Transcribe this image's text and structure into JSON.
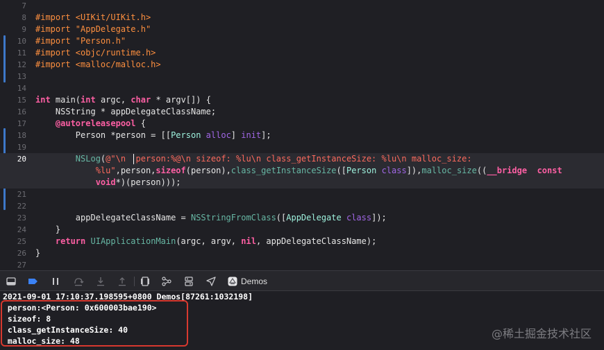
{
  "editor": {
    "lines": [
      {
        "num": "7",
        "tokens": []
      },
      {
        "num": "8",
        "tokens": [
          {
            "t": "#import ",
            "c": "pre"
          },
          {
            "t": "<UIKit/UIKit.h>",
            "c": "pre"
          }
        ]
      },
      {
        "num": "9",
        "tokens": [
          {
            "t": "#import ",
            "c": "pre"
          },
          {
            "t": "\"AppDelegate.h\"",
            "c": "pre"
          }
        ]
      },
      {
        "num": "10",
        "tokens": [
          {
            "t": "#import ",
            "c": "pre"
          },
          {
            "t": "\"Person.h\"",
            "c": "pre"
          }
        ]
      },
      {
        "num": "11",
        "tokens": [
          {
            "t": "#import ",
            "c": "pre"
          },
          {
            "t": "<objc/runtime.h>",
            "c": "pre"
          }
        ]
      },
      {
        "num": "12",
        "tokens": [
          {
            "t": "#import ",
            "c": "pre"
          },
          {
            "t": "<malloc/malloc.h>",
            "c": "pre"
          }
        ]
      },
      {
        "num": "13",
        "tokens": []
      },
      {
        "num": "14",
        "tokens": []
      },
      {
        "num": "15",
        "tokens": [
          {
            "t": "int",
            "c": "kw"
          },
          {
            "t": " main(",
            "c": "plain"
          },
          {
            "t": "int",
            "c": "kw"
          },
          {
            "t": " argc, ",
            "c": "plain"
          },
          {
            "t": "char",
            "c": "kw"
          },
          {
            "t": " * argv[]) {",
            "c": "plain"
          }
        ]
      },
      {
        "num": "16",
        "tokens": [
          {
            "t": "    NSString * appDelegateClassName;",
            "c": "plain"
          }
        ]
      },
      {
        "num": "17",
        "tokens": [
          {
            "t": "    ",
            "c": "plain"
          },
          {
            "t": "@autoreleasepool",
            "c": "kw"
          },
          {
            "t": " {",
            "c": "plain"
          }
        ]
      },
      {
        "num": "18",
        "tokens": [
          {
            "t": "        Person *person = [[",
            "c": "plain"
          },
          {
            "t": "Person",
            "c": "cls"
          },
          {
            "t": " ",
            "c": "plain"
          },
          {
            "t": "alloc",
            "c": "api"
          },
          {
            "t": "] ",
            "c": "plain"
          },
          {
            "t": "init",
            "c": "api"
          },
          {
            "t": "];",
            "c": "plain"
          }
        ]
      },
      {
        "num": "19",
        "tokens": []
      },
      {
        "num": "20",
        "tokens": [
          {
            "t": "        ",
            "c": "plain"
          },
          {
            "t": "NSLog",
            "c": "fn"
          },
          {
            "t": "(",
            "c": "plain"
          },
          {
            "t": "@\"\\n  person:%@\\n sizeof: %lu\\n class_getInstanceSize: %lu\\n malloc_size:",
            "c": "str"
          }
        ]
      },
      {
        "num": "",
        "tokens": [
          {
            "t": "            ",
            "c": "plain"
          },
          {
            "t": "%lu\"",
            "c": "str"
          },
          {
            "t": ",person,",
            "c": "plain"
          },
          {
            "t": "sizeof",
            "c": "kw"
          },
          {
            "t": "(person),",
            "c": "plain"
          },
          {
            "t": "class_getInstanceSize",
            "c": "fn"
          },
          {
            "t": "([",
            "c": "plain"
          },
          {
            "t": "Person",
            "c": "cls"
          },
          {
            "t": " ",
            "c": "plain"
          },
          {
            "t": "class",
            "c": "api"
          },
          {
            "t": "]),",
            "c": "plain"
          },
          {
            "t": "malloc_size",
            "c": "fn"
          },
          {
            "t": "((",
            "c": "plain"
          },
          {
            "t": "__bridge",
            "c": "kw"
          },
          {
            "t": "  ",
            "c": "plain"
          },
          {
            "t": "const",
            "c": "kw"
          }
        ]
      },
      {
        "num": "",
        "tokens": [
          {
            "t": "            ",
            "c": "plain"
          },
          {
            "t": "void",
            "c": "kw"
          },
          {
            "t": "*)(person)));",
            "c": "plain"
          }
        ]
      },
      {
        "num": "21",
        "tokens": []
      },
      {
        "num": "22",
        "tokens": []
      },
      {
        "num": "23",
        "tokens": [
          {
            "t": "        appDelegateClassName = ",
            "c": "plain"
          },
          {
            "t": "NSStringFromClass",
            "c": "fn"
          },
          {
            "t": "([",
            "c": "plain"
          },
          {
            "t": "AppDelegate",
            "c": "cls"
          },
          {
            "t": " ",
            "c": "plain"
          },
          {
            "t": "class",
            "c": "api"
          },
          {
            "t": "]);",
            "c": "plain"
          }
        ]
      },
      {
        "num": "24",
        "tokens": [
          {
            "t": "    }",
            "c": "plain"
          }
        ]
      },
      {
        "num": "25",
        "tokens": [
          {
            "t": "    ",
            "c": "plain"
          },
          {
            "t": "return",
            "c": "kw"
          },
          {
            "t": " ",
            "c": "plain"
          },
          {
            "t": "UIApplicationMain",
            "c": "fn"
          },
          {
            "t": "(argc, argv, ",
            "c": "plain"
          },
          {
            "t": "nil",
            "c": "kw"
          },
          {
            "t": ", appDelegateClassName);",
            "c": "plain"
          }
        ]
      },
      {
        "num": "26",
        "tokens": [
          {
            "t": "}",
            "c": "plain"
          }
        ]
      },
      {
        "num": "27",
        "tokens": []
      }
    ],
    "current_line": "20"
  },
  "debugbar": {
    "target_name": "Demos",
    "icons": [
      "hide-debug-area-icon",
      "breakpoints-toggle-icon",
      "pause-icon",
      "step-over-icon",
      "step-into-icon",
      "step-out-icon",
      "view-hierarchy-icon",
      "memory-graph-icon",
      "environment-overrides-icon",
      "simulate-location-icon",
      "target-app-icon"
    ]
  },
  "console": {
    "lines": [
      "2021-09-01 17:10:37.198595+0800 Demos[87261:1032198]",
      " person:<Person: 0x600003bae190>",
      " sizeof: 8",
      " class_getInstanceSize: 40",
      " malloc_size: 48"
    ],
    "watermark": "@稀土掘金技术社区"
  },
  "colors": {
    "background": "#1f1f24",
    "highlight_box": "#d8392f",
    "change_bar": "#3d78c9"
  }
}
